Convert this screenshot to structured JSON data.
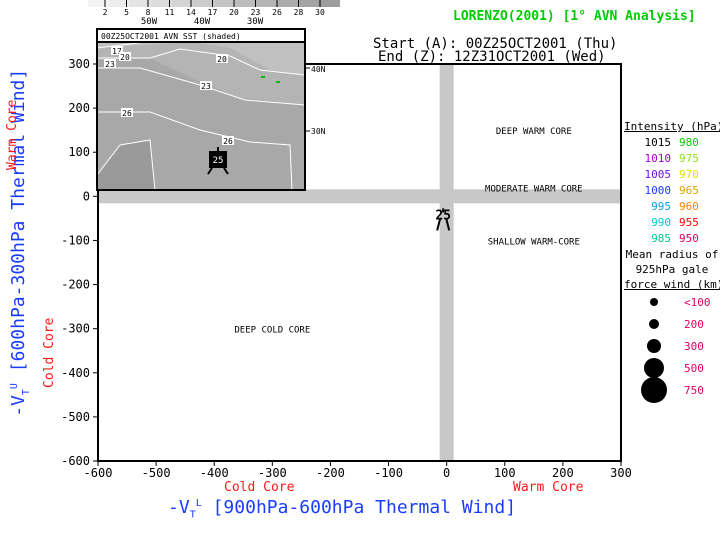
{
  "header": {
    "title": "LORENZO(2001) [1° AVN Analysis]",
    "start": "Start (A): 00Z25OCT2001 (Thu)",
    "end": "End (Z): 12Z31OCT2001 (Wed)"
  },
  "colors": {
    "title": "#00cc00",
    "axis_title": "#1a3cff",
    "core_label": "#ff1a1a",
    "grid_bar": "#c8c8c8"
  },
  "chart_data": {
    "type": "scatter",
    "xlabel": "-V_T^L [900hPa-600hPa Thermal Wind]",
    "xlabel_main": "-V",
    "xlabel_sub": "T",
    "xlabel_sup": "L",
    "xlabel_rest": "[900hPa-600hPa Thermal Wind]",
    "ylabel_main": "-V",
    "ylabel_sub": "T",
    "ylabel_sup": "U",
    "ylabel_rest": "[600hPa-300hPa Thermal Wind]",
    "xlim": [
      -600,
      300
    ],
    "ylim": [
      -600,
      300
    ],
    "xticks": [
      -600,
      -500,
      -400,
      -300,
      -200,
      -100,
      0,
      100,
      200,
      300
    ],
    "yticks": [
      300,
      200,
      100,
      0,
      -100,
      -200,
      -300,
      -400,
      -500,
      -600
    ],
    "x_left_label": "Cold Core",
    "x_right_label": "Warm Core",
    "y_top_label": "Warm Core",
    "y_bottom_label": "Cold Core",
    "regions": [
      {
        "label": "DEEP WARM CORE",
        "x": 150,
        "y": 150
      },
      {
        "label": "MODERATE WARM CORE",
        "x": 150,
        "y": 20
      },
      {
        "label": "SHALLOW WARM-CORE",
        "x": 150,
        "y": -100
      },
      {
        "label": "DEEP COLD CORE",
        "x": -300,
        "y": -300
      }
    ],
    "points": [
      {
        "x": -6,
        "y": -50,
        "label": "25"
      }
    ]
  },
  "legend": {
    "intensity_title": "Intensity (hPa):",
    "intensity": [
      {
        "l": "1015",
        "lc": "#000000",
        "r": "980",
        "rc": "#00cc00"
      },
      {
        "l": "1010",
        "lc": "#a000d0",
        "r": "975",
        "rc": "#90e020"
      },
      {
        "l": "1005",
        "lc": "#7010e0",
        "r": "970",
        "rc": "#e0e000"
      },
      {
        "l": "1000",
        "lc": "#1a3cff",
        "r": "965",
        "rc": "#e0a000"
      },
      {
        "l": "995",
        "lc": "#10a0e0",
        "r": "960",
        "rc": "#ff8000"
      },
      {
        "l": "990",
        "lc": "#00c8c8",
        "r": "955",
        "rc": "#ff0000"
      },
      {
        "l": "985",
        "lc": "#00c890",
        "r": "950",
        "rc": "#e00060"
      }
    ],
    "radius_title_1": "Mean radius of",
    "radius_title_2": "925hPa gale",
    "radius_title_3": "force wind (km):",
    "radius": [
      {
        "label": "<100",
        "size": 4
      },
      {
        "label": "200",
        "size": 5
      },
      {
        "label": "300",
        "size": 7
      },
      {
        "label": "500",
        "size": 10
      },
      {
        "label": "750",
        "size": 13
      }
    ],
    "radius_color": "#e00060"
  },
  "inset": {
    "title": "00Z25OCT2001 AVN SST (shaded)",
    "colorbar_labels": [
      "2",
      "5",
      "8",
      "11",
      "14",
      "17",
      "20",
      "23",
      "26",
      "28",
      "30"
    ],
    "lon_labels": [
      "50W",
      "40W",
      "30W"
    ],
    "lat_labels": [
      "40N",
      "30N"
    ],
    "contour_labels": [
      "17",
      "20",
      "20",
      "23",
      "23",
      "26",
      "26"
    ],
    "storm_label": "25"
  }
}
